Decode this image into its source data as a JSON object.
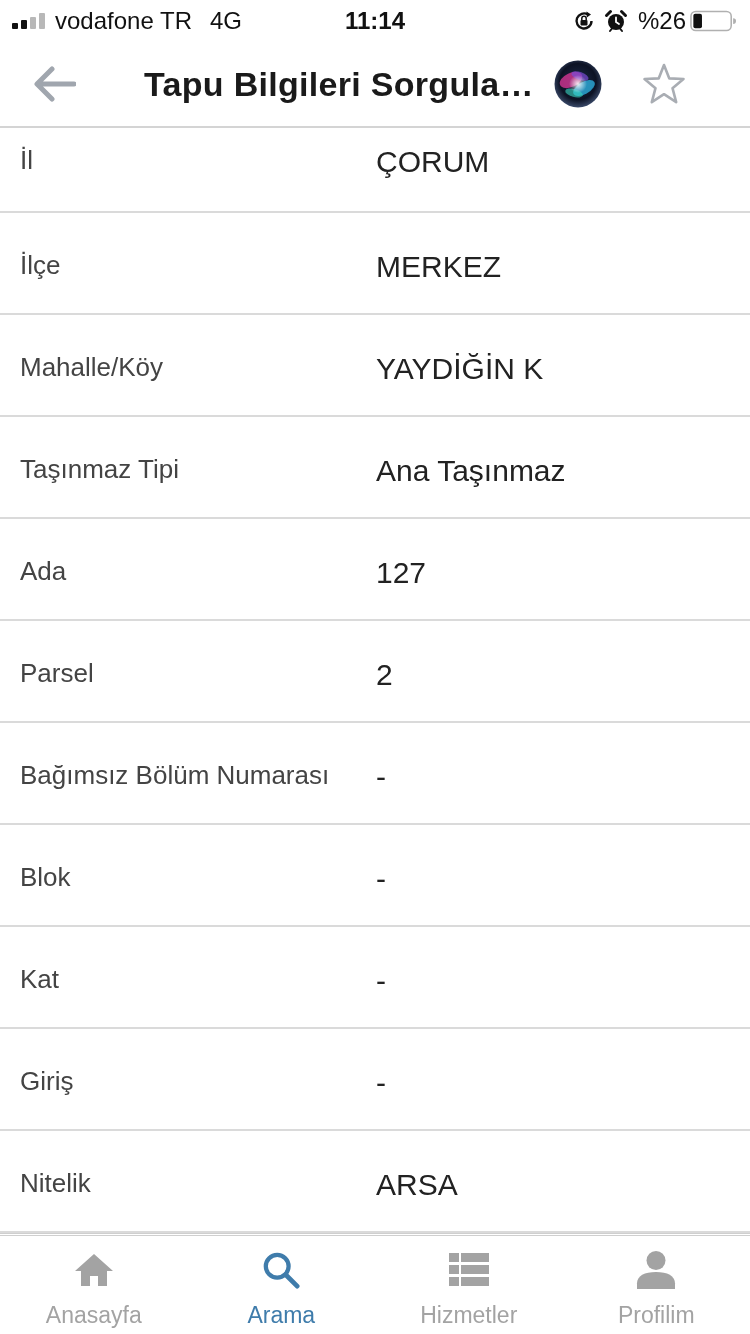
{
  "status_bar": {
    "carrier": "vodafone TR",
    "network": "4G",
    "time": "11:14",
    "battery_percent": "%26"
  },
  "nav_bar": {
    "title": "Tapu Bilgileri Sorgula…"
  },
  "fields": [
    {
      "label": "İl",
      "value": "ÇORUM"
    },
    {
      "label": "İlçe",
      "value": "MERKEZ"
    },
    {
      "label": "Mahalle/Köy",
      "value": "YAYDİĞİN K"
    },
    {
      "label": "Taşınmaz Tipi",
      "value": "Ana Taşınmaz"
    },
    {
      "label": "Ada",
      "value": "127"
    },
    {
      "label": "Parsel",
      "value": "2"
    },
    {
      "label": "Bağımsız Bölüm Numarası",
      "value": "-"
    },
    {
      "label": "Blok",
      "value": "-"
    },
    {
      "label": "Kat",
      "value": "-"
    },
    {
      "label": "Giriş",
      "value": "-"
    },
    {
      "label": "Nitelik",
      "value": "ARSA"
    }
  ],
  "tab_bar": {
    "tabs": [
      {
        "label": "Anasayfa",
        "selected": false
      },
      {
        "label": "Arama",
        "selected": true
      },
      {
        "label": "Hizmetler",
        "selected": false
      },
      {
        "label": "Profilim",
        "selected": false
      }
    ]
  }
}
